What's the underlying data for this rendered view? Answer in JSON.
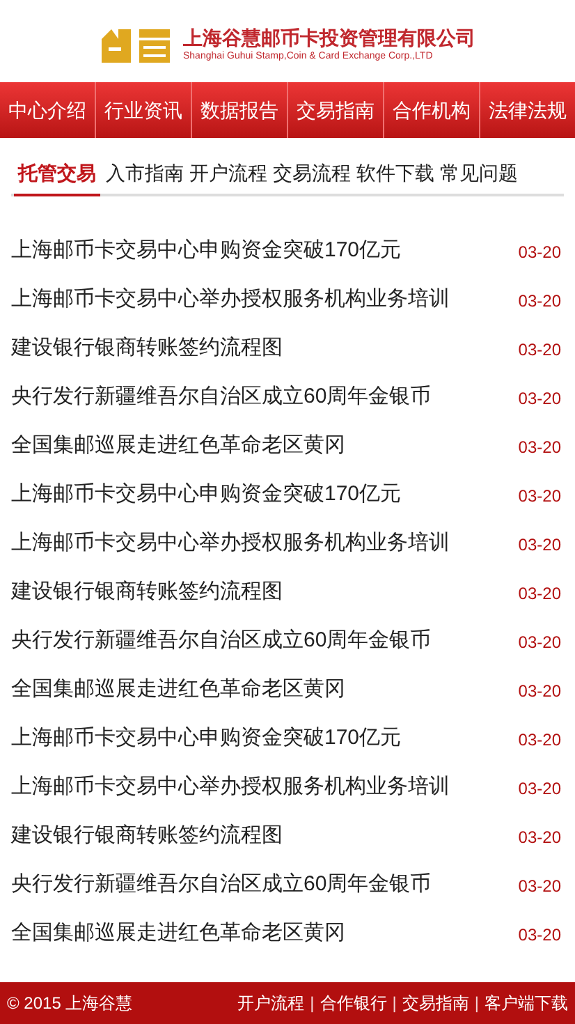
{
  "header": {
    "company_name": "上海谷慧邮币卡投资管理有限公司",
    "company_name_en": "Shanghai Guhui Stamp,Coin & Card Exchange Corp.,LTD"
  },
  "nav": [
    {
      "label": "中心介绍"
    },
    {
      "label": "行业资讯"
    },
    {
      "label": "数据报告"
    },
    {
      "label": "交易指南"
    },
    {
      "label": "合作机构"
    },
    {
      "label": "法律法规"
    }
  ],
  "tabs": [
    {
      "label": "托管交易",
      "selected": true
    },
    {
      "label": "入市指南",
      "selected": false
    },
    {
      "label": "开户流程",
      "selected": false
    },
    {
      "label": "交易流程",
      "selected": false
    },
    {
      "label": "软件下载",
      "selected": false
    },
    {
      "label": "常见问题",
      "selected": false
    }
  ],
  "news": [
    {
      "title": "上海邮币卡交易中心申购资金突破170亿元",
      "date": "03-20"
    },
    {
      "title": "上海邮币卡交易中心举办授权服务机构业务培训",
      "date": "03-20"
    },
    {
      "title": "建设银行银商转账签约流程图",
      "date": "03-20"
    },
    {
      "title": "央行发行新疆维吾尔自治区成立60周年金银币",
      "date": "03-20"
    },
    {
      "title": "全国集邮巡展走进红色革命老区黄冈",
      "date": "03-20"
    },
    {
      "title": "上海邮币卡交易中心申购资金突破170亿元",
      "date": "03-20"
    },
    {
      "title": "上海邮币卡交易中心举办授权服务机构业务培训",
      "date": "03-20"
    },
    {
      "title": "建设银行银商转账签约流程图",
      "date": "03-20"
    },
    {
      "title": "央行发行新疆维吾尔自治区成立60周年金银币",
      "date": "03-20"
    },
    {
      "title": "全国集邮巡展走进红色革命老区黄冈",
      "date": "03-20"
    },
    {
      "title": "上海邮币卡交易中心申购资金突破170亿元",
      "date": "03-20"
    },
    {
      "title": "上海邮币卡交易中心举办授权服务机构业务培训",
      "date": "03-20"
    },
    {
      "title": "建设银行银商转账签约流程图",
      "date": "03-20"
    },
    {
      "title": "央行发行新疆维吾尔自治区成立60周年金银币",
      "date": "03-20"
    },
    {
      "title": "全国集邮巡展走进红色革命老区黄冈",
      "date": "03-20"
    }
  ],
  "footer": {
    "copyright": "© 2015 上海谷慧",
    "items": [
      {
        "kind": "link",
        "text": "开户流程"
      },
      {
        "kind": "separator",
        "text": "|"
      },
      {
        "kind": "link",
        "text": "合作银行"
      },
      {
        "kind": "separator",
        "text": "|"
      },
      {
        "kind": "link",
        "text": "交易指南"
      },
      {
        "kind": "separator",
        "text": "|"
      },
      {
        "kind": "link",
        "text": "客户端下载"
      }
    ]
  }
}
